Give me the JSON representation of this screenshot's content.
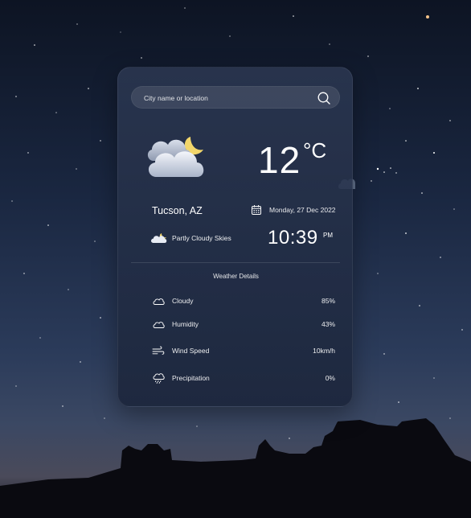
{
  "search": {
    "placeholder": "City name or location",
    "value": ""
  },
  "current": {
    "temperature": "12",
    "unit": "°C",
    "location": "Tucson, AZ",
    "date": "Monday, 27 Dec 2022",
    "condition": "Partly Cloudy Skies",
    "time": "10:39",
    "ampm": "PM"
  },
  "details": {
    "heading": "Weather Details",
    "items": [
      {
        "label": "Cloudy",
        "value": "85%",
        "icon": "cloud-icon"
      },
      {
        "label": "Humidity",
        "value": "43%",
        "icon": "cloud-icon"
      },
      {
        "label": "Wind Speed",
        "value": "10km/h",
        "icon": "wind-icon"
      },
      {
        "label": "Precipitation",
        "value": "0%",
        "icon": "rain-cloud-icon"
      }
    ]
  },
  "colors": {
    "accent_moon": "#f2d66b",
    "card": "#26324c",
    "sky_top": "#0d1423"
  }
}
